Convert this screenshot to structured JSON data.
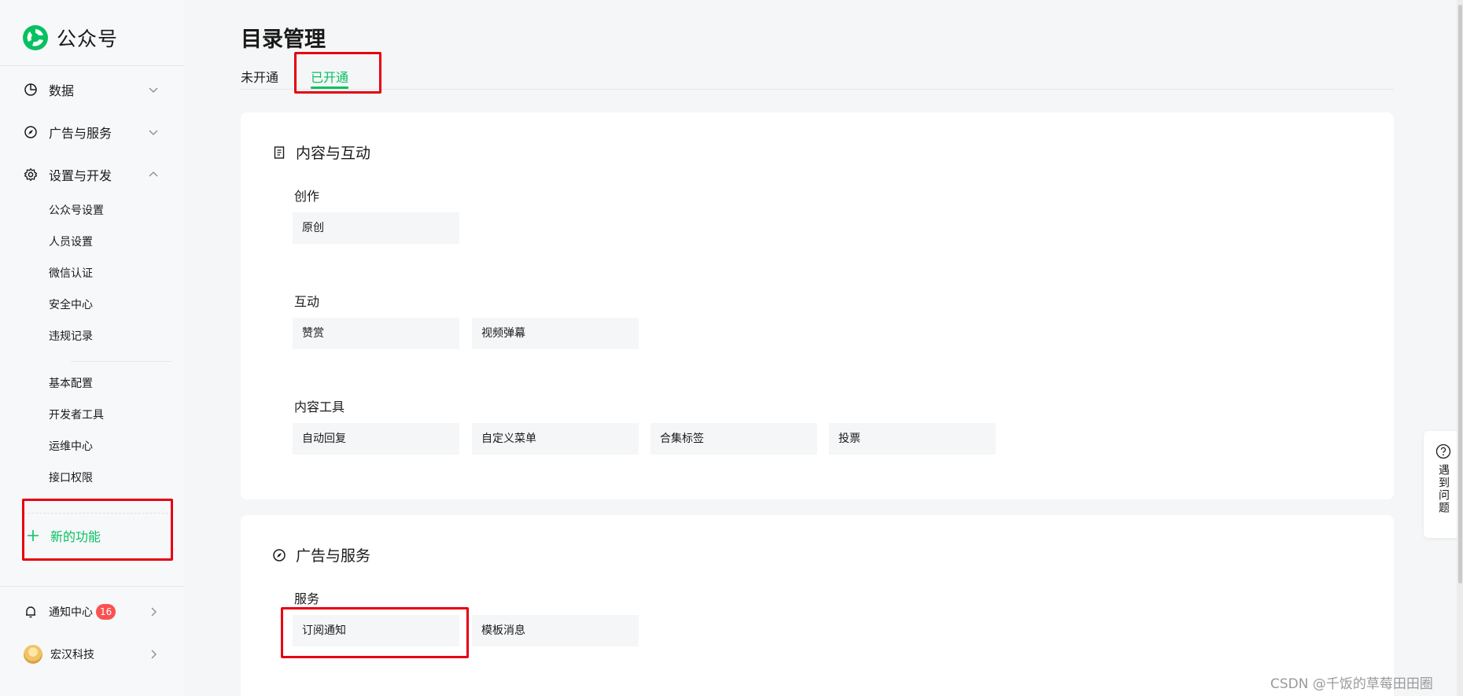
{
  "brand": {
    "name": "公众号"
  },
  "sidebar": {
    "groups": [
      {
        "label": "数据",
        "icon": "pie-chart-icon"
      },
      {
        "label": "广告与服务",
        "icon": "compass-icon"
      },
      {
        "label": "设置与开发",
        "icon": "gear-icon"
      }
    ],
    "sub_items": [
      {
        "label": "公众号设置"
      },
      {
        "label": "人员设置"
      },
      {
        "label": "微信认证"
      },
      {
        "label": "安全中心"
      },
      {
        "label": "违规记录"
      },
      {
        "label": "基本配置"
      },
      {
        "label": "开发者工具"
      },
      {
        "label": "运维中心"
      },
      {
        "label": "接口权限"
      }
    ],
    "new_function": {
      "label": "新的功能"
    },
    "notifications": {
      "label": "通知中心",
      "count": "16"
    },
    "account": {
      "label": "宏汉科技"
    }
  },
  "page": {
    "title": "目录管理",
    "tabs": [
      {
        "label": "未开通"
      },
      {
        "label": "已开通"
      }
    ]
  },
  "sections": [
    {
      "title": "内容与互动",
      "icon": "document-icon",
      "groups": [
        {
          "label": "创作",
          "items": [
            "原创"
          ]
        },
        {
          "label": "互动",
          "items": [
            "赞赏",
            "视频弹幕"
          ]
        },
        {
          "label": "内容工具",
          "items": [
            "自动回复",
            "自定义菜单",
            "合集标签",
            "投票"
          ]
        }
      ]
    },
    {
      "title": "广告与服务",
      "icon": "compass-icon",
      "groups": [
        {
          "label": "服务",
          "items": [
            "订阅通知",
            "模板消息"
          ]
        }
      ]
    }
  ],
  "help": {
    "label": "遇到问题"
  },
  "watermark": "CSDN @千饭的草莓田田圈",
  "colors": {
    "accent": "#07c160",
    "highlight": "#e60012",
    "badge": "#fa5151"
  }
}
